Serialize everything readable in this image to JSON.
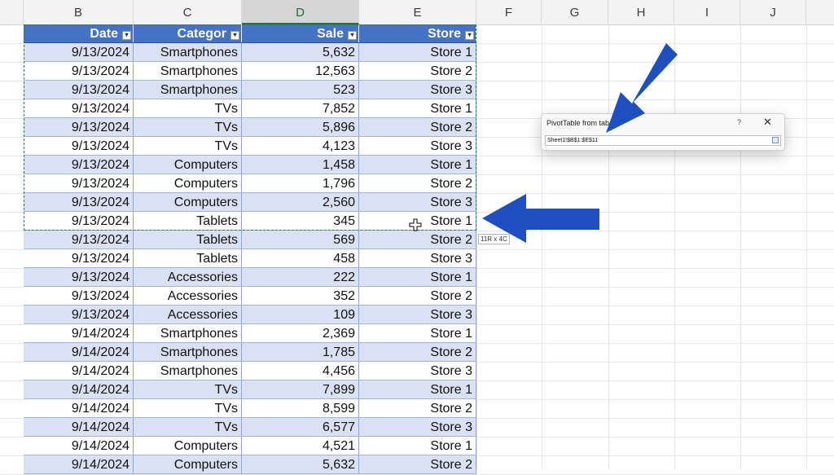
{
  "columns": [
    "B",
    "C",
    "D",
    "E",
    "F",
    "G",
    "H",
    "I",
    "J"
  ],
  "selected_column": "D",
  "table": {
    "headers": [
      "Date",
      "Categor",
      "Sale",
      "Store"
    ],
    "rows": [
      [
        "9/13/2024",
        "Smartphones",
        "5,632",
        "Store 1"
      ],
      [
        "9/13/2024",
        "Smartphones",
        "12,563",
        "Store 2"
      ],
      [
        "9/13/2024",
        "Smartphones",
        "523",
        "Store 3"
      ],
      [
        "9/13/2024",
        "TVs",
        "7,852",
        "Store 1"
      ],
      [
        "9/13/2024",
        "TVs",
        "5,896",
        "Store 2"
      ],
      [
        "9/13/2024",
        "TVs",
        "4,123",
        "Store 3"
      ],
      [
        "9/13/2024",
        "Computers",
        "1,458",
        "Store 1"
      ],
      [
        "9/13/2024",
        "Computers",
        "1,796",
        "Store 2"
      ],
      [
        "9/13/2024",
        "Computers",
        "2,560",
        "Store 3"
      ],
      [
        "9/13/2024",
        "Tablets",
        "345",
        "Store 1"
      ],
      [
        "9/13/2024",
        "Tablets",
        "569",
        "Store 2"
      ],
      [
        "9/13/2024",
        "Tablets",
        "458",
        "Store 3"
      ],
      [
        "9/13/2024",
        "Accessories",
        "222",
        "Store 1"
      ],
      [
        "9/13/2024",
        "Accessories",
        "352",
        "Store 2"
      ],
      [
        "9/13/2024",
        "Accessories",
        "109",
        "Store 3"
      ],
      [
        "9/14/2024",
        "Smartphones",
        "2,369",
        "Store 1"
      ],
      [
        "9/14/2024",
        "Smartphones",
        "1,785",
        "Store 2"
      ],
      [
        "9/14/2024",
        "Smartphones",
        "4,456",
        "Store 3"
      ],
      [
        "9/14/2024",
        "TVs",
        "7,899",
        "Store 1"
      ],
      [
        "9/14/2024",
        "TVs",
        "8,599",
        "Store 2"
      ],
      [
        "9/14/2024",
        "TVs",
        "6,577",
        "Store 3"
      ],
      [
        "9/14/2024",
        "Computers",
        "4,521",
        "Store 1"
      ],
      [
        "9/14/2024",
        "Computers",
        "5,632",
        "Store 2"
      ]
    ]
  },
  "dialog": {
    "title": "PivotTable from tab",
    "help": "?",
    "close": "✕",
    "range_value": "Sheet1!$B$1:$E$11"
  },
  "tooltip": "11R x 4C",
  "colors": {
    "header_fill": "#4472c4",
    "band_fill": "#d9e1f2",
    "arrow_fill": "#1f4fbf",
    "selection_border": "#2e7d4f"
  },
  "icons": [
    "filter-dropdown-icon",
    "move-cursor-icon",
    "collapse-dialog-icon",
    "close-icon",
    "help-icon",
    "arrow-pointer"
  ]
}
